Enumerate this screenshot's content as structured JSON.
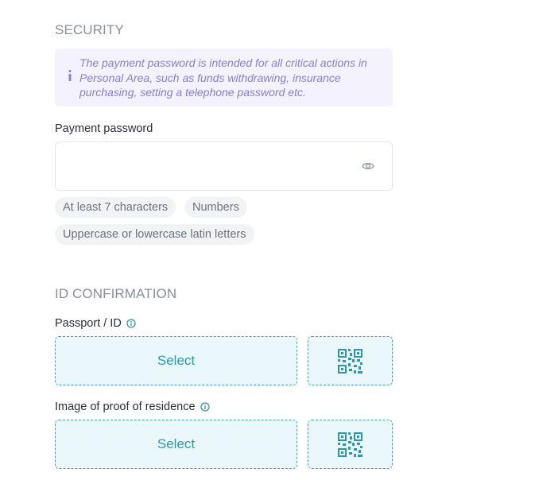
{
  "security": {
    "title": "SECURITY",
    "info_text": "The payment password is intended for all critical actions in Personal Area, such as funds withdrawing, insurance purchasing, setting a telephone password etc.",
    "payment_password": {
      "label": "Payment password",
      "value": "",
      "placeholder": ""
    },
    "requirements": [
      "At least 7 characters",
      "Numbers",
      "Uppercase or lowercase latin letters"
    ]
  },
  "id_confirmation": {
    "title": "ID CONFIRMATION",
    "passport": {
      "label": "Passport / ID",
      "select_label": "Select"
    },
    "residence": {
      "label": "Image of proof of residence",
      "select_label": "Select"
    }
  },
  "colors": {
    "accent_teal": "#2b99ab",
    "info_purple": "#8a7fd9",
    "info_bg": "#f3f2fd",
    "upload_bg": "#eaf7fb"
  },
  "icons": {
    "info": "info-icon",
    "password_visibility": "eye-icon",
    "tooltip": "info-circle-icon",
    "qr": "qr-code-icon"
  }
}
